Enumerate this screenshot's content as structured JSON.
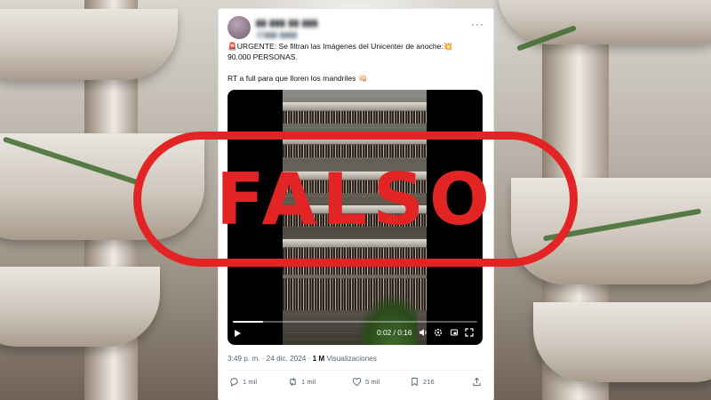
{
  "tweet": {
    "author_name": "▮▮ ▮▮▮ ▮▮ ▮▮▮",
    "author_handle": "@▮▮▮ ▮▮▮▮",
    "more_glyph": "···",
    "line1_emoji": "🚨",
    "line1": "URGENTE: Se filtran las Imágenes del Unicenter de anoche:",
    "line1_emoji_end": "💥",
    "line2": "90.000 PERSONAS.",
    "line3": "RT a full para que lloren los mandriles",
    "line3_emoji": "👊🏻",
    "time": "3:49 p. m. · 24 dic. 2024 ·",
    "views_count": "1 M",
    "views_label": "Visualizaciones"
  },
  "video": {
    "time": "0:02 / 0:16",
    "progress": 0.125
  },
  "actions": {
    "replies": "1 mil",
    "retweets": "1 mil",
    "likes": "5 mil",
    "bookmarks": "216"
  },
  "stamp": {
    "text": "FALSO",
    "color": "#e32424"
  },
  "icons": [
    "avatar",
    "more-icon",
    "play-icon",
    "volume-icon",
    "settings-icon",
    "replay-icon",
    "fullscreen-icon",
    "reply-icon",
    "retweet-icon",
    "like-icon",
    "bookmark-icon",
    "share-icon"
  ]
}
